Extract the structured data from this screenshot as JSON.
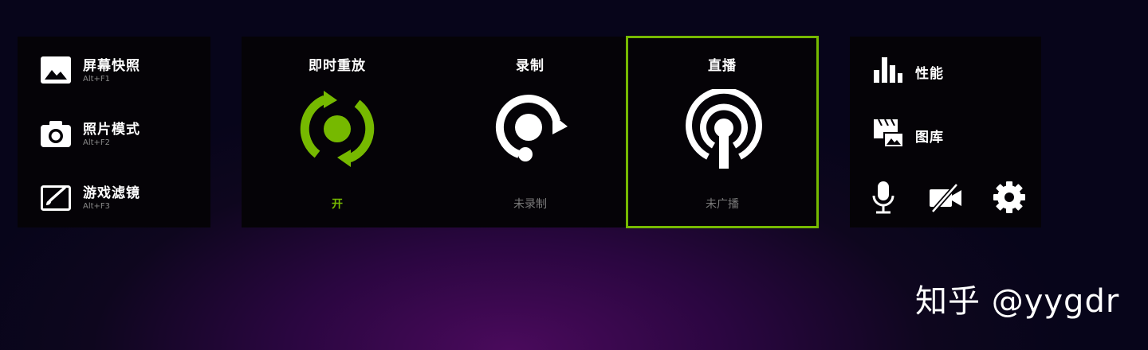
{
  "left_menu": {
    "items": [
      {
        "label": "屏幕快照",
        "shortcut": "Alt+F1",
        "icon": "image-icon"
      },
      {
        "label": "照片模式",
        "shortcut": "Alt+F2",
        "icon": "camera-icon"
      },
      {
        "label": "游戏滤镜",
        "shortcut": "Alt+F3",
        "icon": "filter-brush-icon"
      }
    ]
  },
  "features": [
    {
      "title": "即时重放",
      "status": "开",
      "icon": "instant-replay-icon"
    },
    {
      "title": "录制",
      "status": "未录制",
      "icon": "record-icon"
    },
    {
      "title": "直播",
      "status": "未广播",
      "icon": "broadcast-icon"
    }
  ],
  "right_menu": {
    "items": [
      {
        "label": "性能",
        "icon": "bar-chart-icon"
      },
      {
        "label": "图库",
        "icon": "gallery-icon"
      }
    ],
    "buttons": [
      "microphone-icon",
      "camera-off-icon",
      "gear-icon"
    ]
  },
  "watermark": "知乎 @yygdr",
  "colors": {
    "accent": "#76b900",
    "panel": "#050307",
    "muted": "#7a7a7a"
  }
}
